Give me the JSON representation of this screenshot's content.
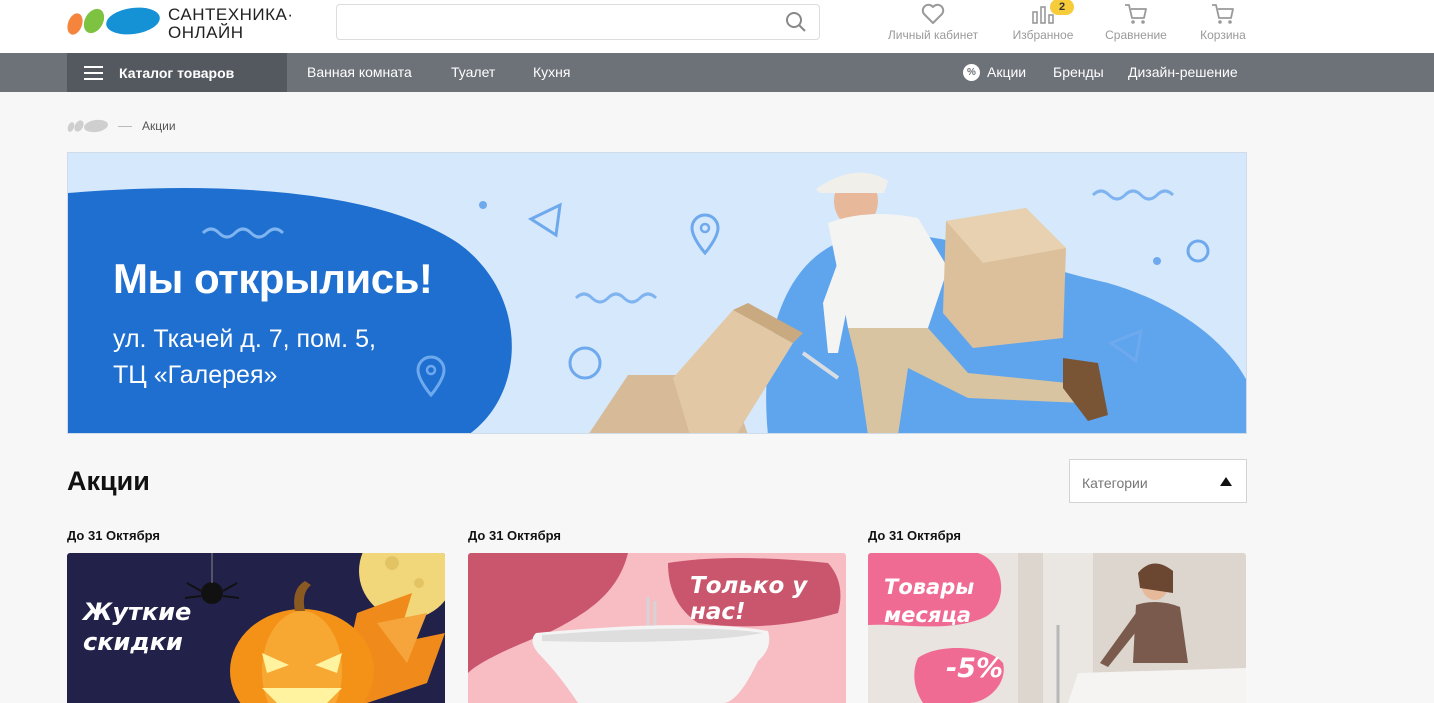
{
  "header": {
    "logo_text_line1": "САНТЕХНИКА·",
    "logo_text_line2": "ОНЛАЙН",
    "search": {
      "placeholder": "",
      "value": ""
    },
    "actions": [
      {
        "label": "Личный кабинет",
        "icon": "heart-icon"
      },
      {
        "label": "Избранное",
        "icon": "bar-chart-icon",
        "badge": "2"
      },
      {
        "label": "Сравнение",
        "icon": "cart-icon"
      },
      {
        "label": "Корзина",
        "icon": "cart-icon"
      }
    ]
  },
  "nav": {
    "catalog_label": "Каталог товаров",
    "links": [
      "Ванная комната",
      "Туалет",
      "Кухня"
    ],
    "right_links": [
      {
        "label": "Акции",
        "icon": "percent-icon",
        "icon_text": "%"
      },
      {
        "label": "Бренды"
      },
      {
        "label": "Дизайн-решение"
      }
    ]
  },
  "breadcrumb": {
    "current": "Акции"
  },
  "banner": {
    "title": "Мы открылись!",
    "address_line1": "ул. Ткачей д. 7, пом. 5,",
    "address_line2": "ТЦ «Галерея»"
  },
  "section": {
    "title": "Акции",
    "category_select": "Категории"
  },
  "promos": [
    {
      "date": "До 31 Октября",
      "caption_line1": "Жуткие",
      "caption_line2": "скидки"
    },
    {
      "date": "До 31 Октября",
      "caption_line1": "Только у нас!",
      "caption_line2": ""
    },
    {
      "date": "До 31 Октября",
      "caption_line1": "Товары",
      "caption_line2": "месяца",
      "discount": "-5%"
    }
  ],
  "colors": {
    "nav_bg": "#6d7178",
    "catalog_bg": "#54585f",
    "banner_blue": "#1e6fcf",
    "badge": "#f6cc3a",
    "logo_orange": "#f5843d",
    "logo_green": "#7dc241",
    "logo_blue": "#1591d6"
  }
}
